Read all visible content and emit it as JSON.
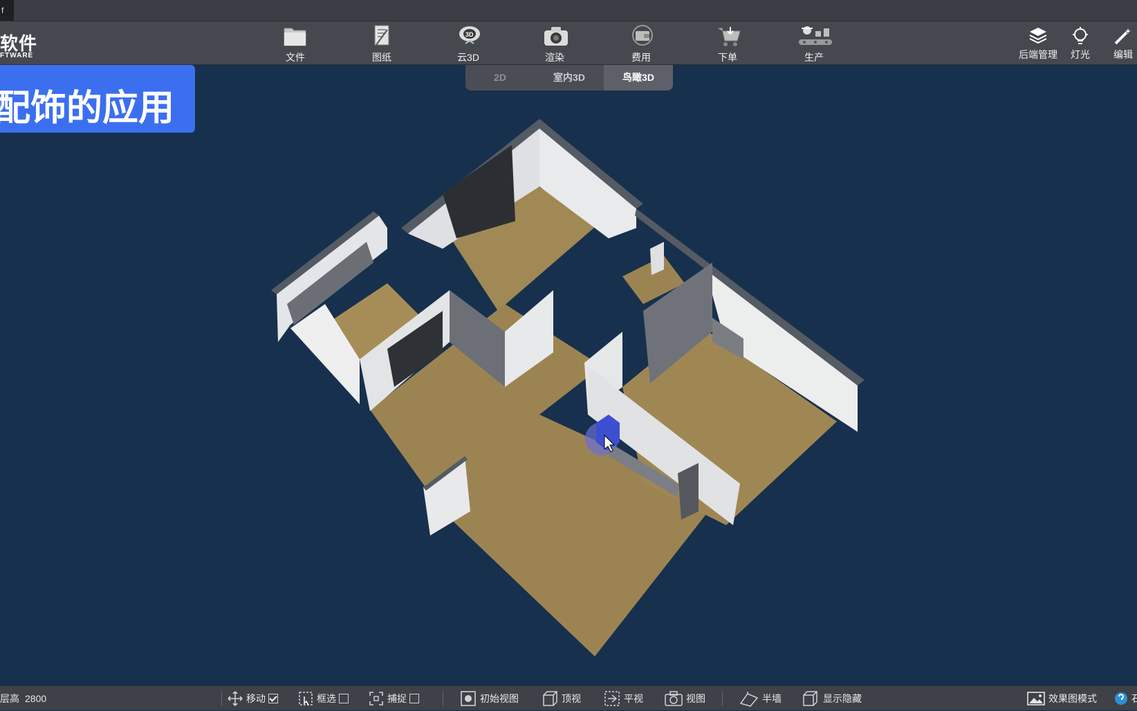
{
  "window": {
    "tab_stub": "f"
  },
  "logo": {
    "line1": "软件",
    "line2": "FTWARE"
  },
  "toolbar": {
    "items": [
      {
        "label": "文件",
        "icon": "folder-icon"
      },
      {
        "label": "图纸",
        "icon": "drawing-icon"
      },
      {
        "label": "云3D",
        "icon": "cloud-3d-icon",
        "badge": "3D"
      },
      {
        "label": "渲染",
        "icon": "camera-icon"
      },
      {
        "label": "费用",
        "icon": "wallet-icon"
      },
      {
        "label": "下单",
        "icon": "cart-download-icon"
      },
      {
        "label": "生产",
        "icon": "production-line-icon"
      }
    ],
    "right_items": [
      {
        "label": "后端管理",
        "icon": "layers-icon"
      },
      {
        "label": "灯光",
        "icon": "lightbulb-icon"
      },
      {
        "label": "编辑",
        "icon": "wand-icon"
      }
    ]
  },
  "view_tabs": {
    "items": [
      "2D",
      "室内3D",
      "鸟瞰3D"
    ],
    "active": "鸟瞰3D"
  },
  "banner": {
    "text": "配饰的应用",
    "color": "#3c6ff0"
  },
  "status_bar": {
    "floor_height_label": "层高",
    "floor_height_value": "2800",
    "move": {
      "label": "移动",
      "checked": true
    },
    "box_select": {
      "label": "框选",
      "checked": false
    },
    "snap": {
      "label": "捕捉",
      "checked": false
    },
    "initial_view": "初始视图",
    "top_view": "顶视",
    "plan_view": "平视",
    "view": "视图",
    "half_wall": "半墙",
    "show_hide": "显示隐藏",
    "render_mode": "效果图模式",
    "cut_label": "石"
  },
  "colors": {
    "background": "#17304d",
    "toolbar": "#45484f",
    "floor": "#9c8452",
    "wall": "#e9eaec",
    "accent": "#3c6ff0"
  }
}
